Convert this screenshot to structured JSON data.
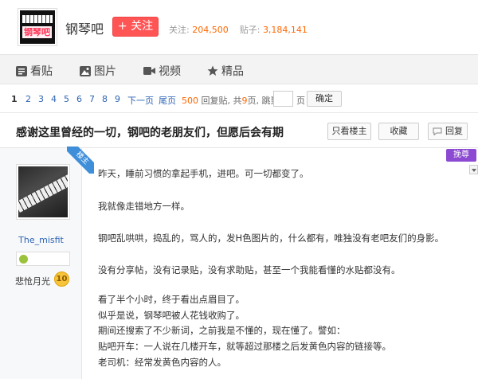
{
  "header": {
    "logo_text": "钢琴吧",
    "forum_name": "钢琴吧",
    "follow_label": "+ 关注",
    "follow_stat_label": "关注:",
    "follow_stat_value": "204,500",
    "post_stat_label": "贴子:",
    "post_stat_value": "3,184,141"
  },
  "nav": {
    "items": [
      {
        "label": "看贴",
        "icon": "post-list-icon"
      },
      {
        "label": "图片",
        "icon": "image-icon"
      },
      {
        "label": "视频",
        "icon": "video-icon"
      },
      {
        "label": "精品",
        "icon": "star-icon"
      }
    ]
  },
  "pager": {
    "pages": [
      "1",
      "2",
      "3",
      "4",
      "5",
      "6",
      "7",
      "8",
      "9"
    ],
    "current": "1",
    "next": "下一页",
    "last": "尾页",
    "reply_count": "500",
    "reply_label": "回复贴,",
    "total_prefix": "共",
    "total_pages": "9",
    "total_suffix": "页,",
    "jump_label": "跳到",
    "page_unit": "页",
    "confirm": "确定"
  },
  "thread": {
    "title": "感谢这里曾经的一切，钢吧的老朋友们，但愿后会有期",
    "only_op": "只看楼主",
    "favorite": "收藏",
    "reply": "回复"
  },
  "author": {
    "op_tag": "楼主",
    "username": "The_misfit",
    "level_name": "悲怆月光",
    "level": "10"
  },
  "plugin_label": "挽尊",
  "post": {
    "paragraphs": [
      "昨天，睡前习惯的拿起手机，进吧。可一切都变了。",
      "我就像走错地方一样。",
      "钢吧乱哄哄，捣乱的，骂人的，发H色图片的，什么都有，唯独没有老吧友们的身影。",
      "没有分享帖，没有记录贴，没有求助贴，甚至一个我能看懂的水贴都没有。",
      "看了半个小时，终于看出点眉目了。",
      "似乎是说，钢琴吧被人花钱收购了。",
      "期间还搜索了不少新词，之前我是不懂的，现在懂了。譬如：",
      "贴吧开车：一人说在几楼开车，就等超过那楼之后发黄色内容的链接等。",
      "老司机：经常发黄色内容的人。"
    ]
  },
  "colors": {
    "accent_link": "#2d64b3",
    "follow_button": "#ff5555",
    "stat_number": "#ff6600",
    "op_tag": "#3e8ed9",
    "plugin": "#8b4ad1"
  }
}
